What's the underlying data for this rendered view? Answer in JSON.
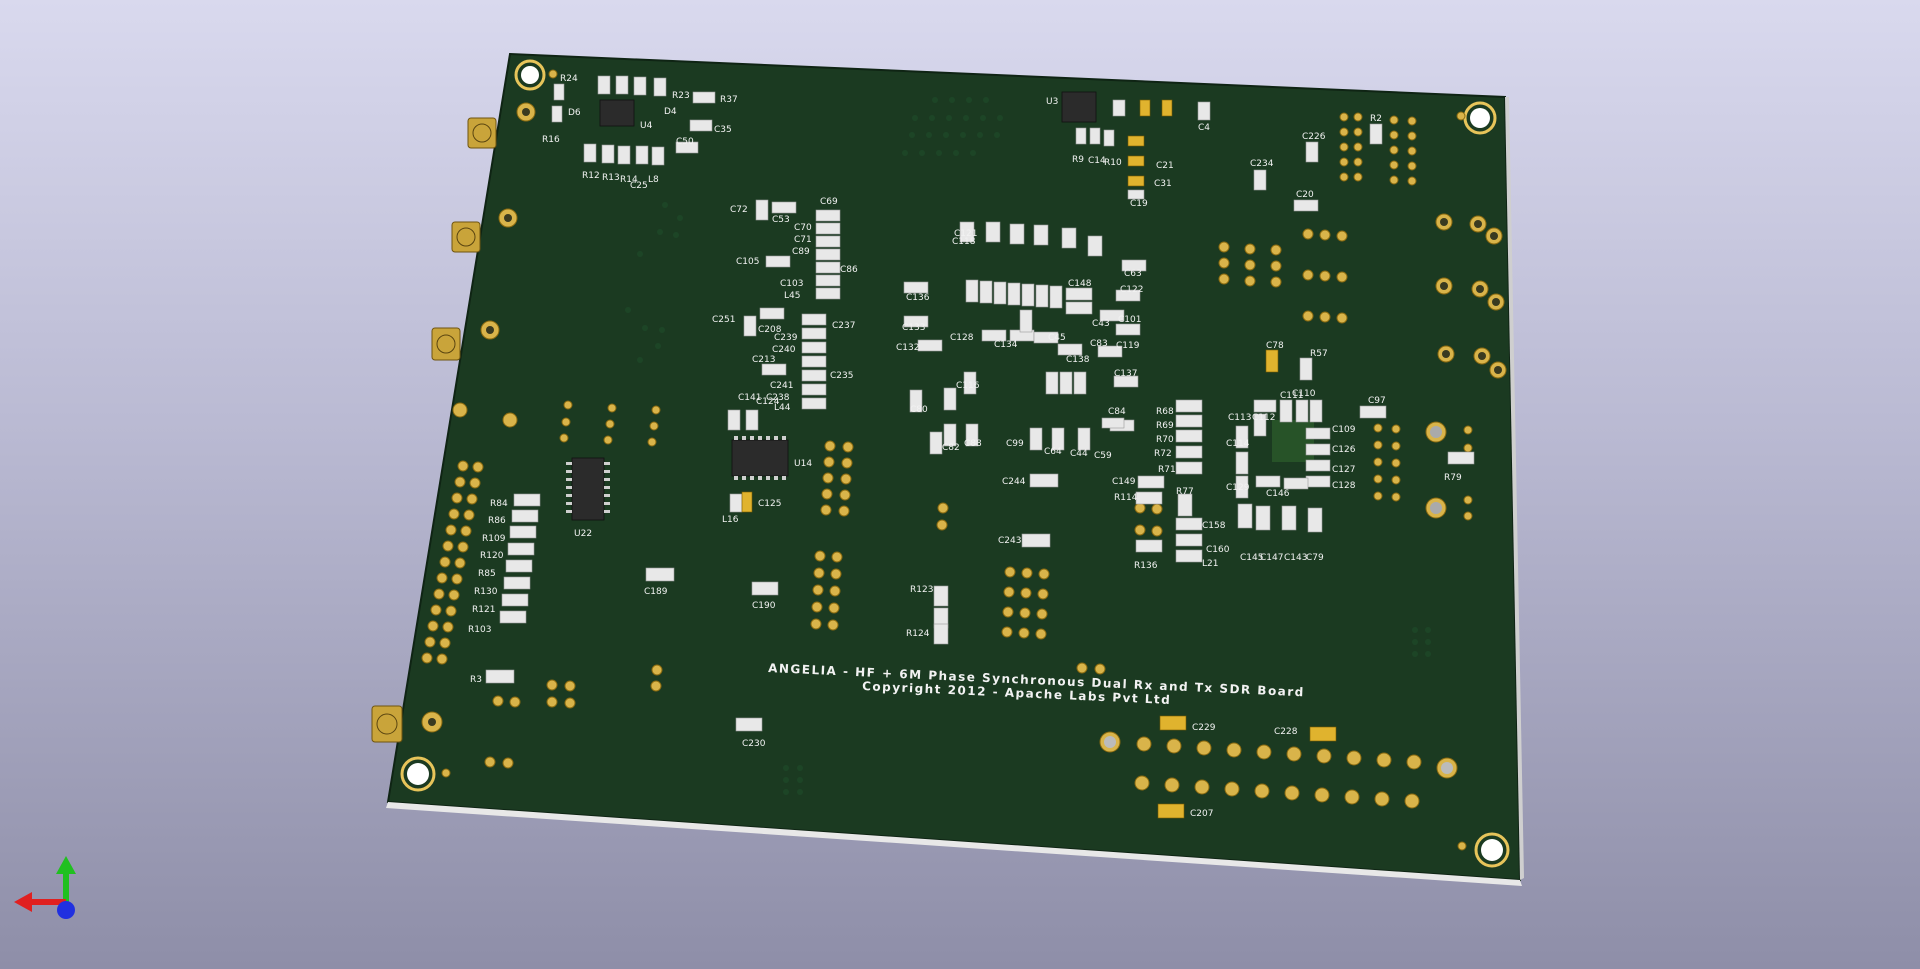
{
  "board": {
    "title_line1": "ANGELIA - HF + 6M Phase Synchronous Dual Rx and Tx SDR Board",
    "title_line2": "Copyright 2012 - Apache Labs Pvt Ltd"
  },
  "colors": {
    "background_top": "#d9d9ee",
    "background_bottom": "#8e8ea8",
    "pcb": "#1c3b22",
    "pad_gold": "#d9b44a",
    "silkscreen": "#f2f2f2",
    "axis_x": "#e02020",
    "axis_y": "#20c020",
    "axis_z": "#2030e0"
  },
  "labels": {
    "R24": "R24",
    "R23": "R23",
    "R37": "R37",
    "D4": "D4",
    "D6": "D6",
    "U4": "U4",
    "R16": "R16",
    "C35": "C35",
    "C50": "C50",
    "R12": "R12",
    "R13": "R13",
    "R14": "R14",
    "C25": "C25",
    "L8": "L8",
    "U3": "U3",
    "C21": "C21",
    "C31": "C31",
    "C19": "C19",
    "C4": "C4",
    "R9": "R9",
    "C14": "C14",
    "R10": "R10",
    "C226": "C226",
    "R2": "R2",
    "C234": "C234",
    "C20": "C20",
    "C72": "C72",
    "C53": "C53",
    "C69": "C69",
    "C70": "C70",
    "C71": "C71",
    "C89": "C89",
    "C105": "C105",
    "C86": "C86",
    "C103": "C103",
    "L45": "L45",
    "C121": "C121",
    "C118": "C118",
    "C136": "C136",
    "C133": "C133",
    "C122": "C122",
    "C63": "C63",
    "C148": "C148",
    "C43": "C43",
    "C101": "C101",
    "C45": "C45",
    "C128": "C128",
    "C134": "C134",
    "C83": "C83",
    "C138": "C138",
    "C119": "C119",
    "C137": "C137",
    "C132": "C132",
    "C116": "C116",
    "C251": "C251",
    "C208": "C208",
    "C237": "C237",
    "C239": "C239",
    "C240": "C240",
    "C235": "C235",
    "C213": "C213",
    "C241": "C241",
    "C238": "C238",
    "L44": "L44",
    "C141": "C141",
    "C124": "C124",
    "U14": "U14",
    "C125": "C125",
    "L16": "L16",
    "U22": "U22",
    "R84": "R84",
    "R86": "R86",
    "R109": "R109",
    "R120": "R120",
    "R85": "R85",
    "R130": "R130",
    "R121": "R121",
    "R103": "R103",
    "C189": "C189",
    "C190": "C190",
    "R3": "R3",
    "C78": "C78",
    "R57": "R57",
    "C97": "C97",
    "C111": "C111",
    "C110": "C110",
    "C113": "C113",
    "C112": "C112",
    "C109": "C109",
    "C126": "C126",
    "C127": "C127",
    "C128b": "C128",
    "C114": "C114",
    "C129": "C129",
    "C146": "C146",
    "C145": "C145",
    "C147": "C147",
    "C143": "C143",
    "C79": "C79",
    "R68": "R68",
    "R69": "R69",
    "R70": "R70",
    "R72": "R72",
    "R71": "R71",
    "R79": "R79",
    "C84": "C84",
    "C99": "C99",
    "C64": "C64",
    "C44": "C44",
    "C59": "C59",
    "C82": "C82",
    "C88": "C88",
    "C80": "C80",
    "C244": "C244",
    "C149": "C149",
    "R114": "R114",
    "R77": "R77",
    "C158": "C158",
    "C160": "C160",
    "R136": "R136",
    "L21": "L21",
    "C243": "C243",
    "R123": "R123",
    "R124": "R124",
    "C229": "C229",
    "C228": "C228",
    "C230": "C230",
    "C207": "C207"
  }
}
